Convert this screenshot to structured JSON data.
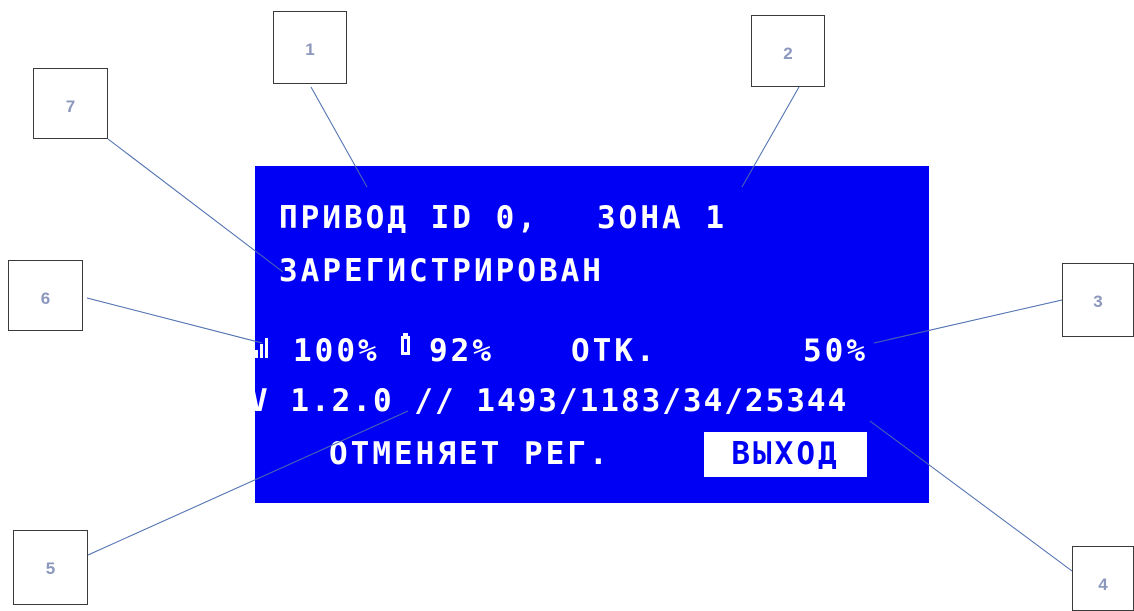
{
  "lcd": {
    "title_line": "ПРИВОД ID 0,",
    "zone_label": "ЗОНА 1",
    "status_line": "ЗАРЕГИСТРИРОВАН",
    "signal_value": "100%",
    "battery_value": "92%",
    "valve_state": "ОТК.",
    "opening_value": "50%",
    "version_line": "V 1.2.0 // 1493/1183/34/25344",
    "cancel_registration": "ОТМЕНЯЕТ РЕГ.",
    "exit_label": "ВЫХОД",
    "background_color": "#0000f5",
    "text_color": "#ffffff"
  },
  "icons": {
    "signal": "signal-strength-icon",
    "battery": "battery-icon"
  },
  "callouts": [
    "1",
    "2",
    "3",
    "4",
    "5",
    "6",
    "7"
  ],
  "colors": {
    "callout_number": "#8c97bd",
    "leader_line": "#4a6cae"
  }
}
